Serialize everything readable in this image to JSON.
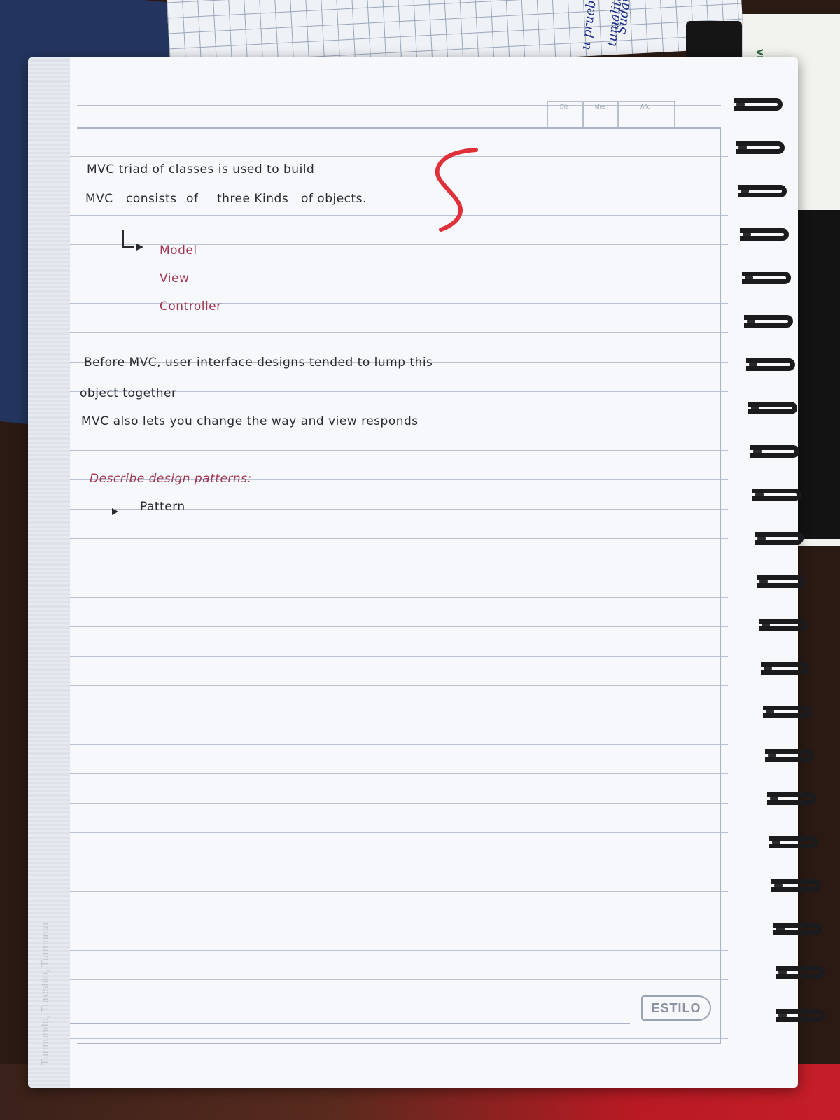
{
  "notebook": {
    "brand_logo": "ESTILO",
    "margin_print": "Turmundo, Turestilo, Turmarca",
    "date_labels": [
      "Día",
      "Mes",
      "Año"
    ]
  },
  "grade": {
    "value": "5",
    "color": "#e0313b"
  },
  "notes": {
    "line1": "MVC triad of classes is used to build",
    "line2_a": "MVC",
    "line2_b": "consists",
    "line2_c": "of",
    "line2_d": "three Kinds",
    "line2_e": "of objects.",
    "list": [
      "Model",
      "View",
      "Controller"
    ],
    "para1_line1": "Before MVC, user interface designs tended to lump this",
    "para1_line2": "object together",
    "para2": "MVC also lets you change the way and view responds",
    "heading": "Describe design patterns:",
    "bullet": "Pattern"
  },
  "top_sheet_scrawl": [
    "u prueba",
    "Sudam",
    "tumalito"
  ],
  "side_box_label": "VELOSA"
}
